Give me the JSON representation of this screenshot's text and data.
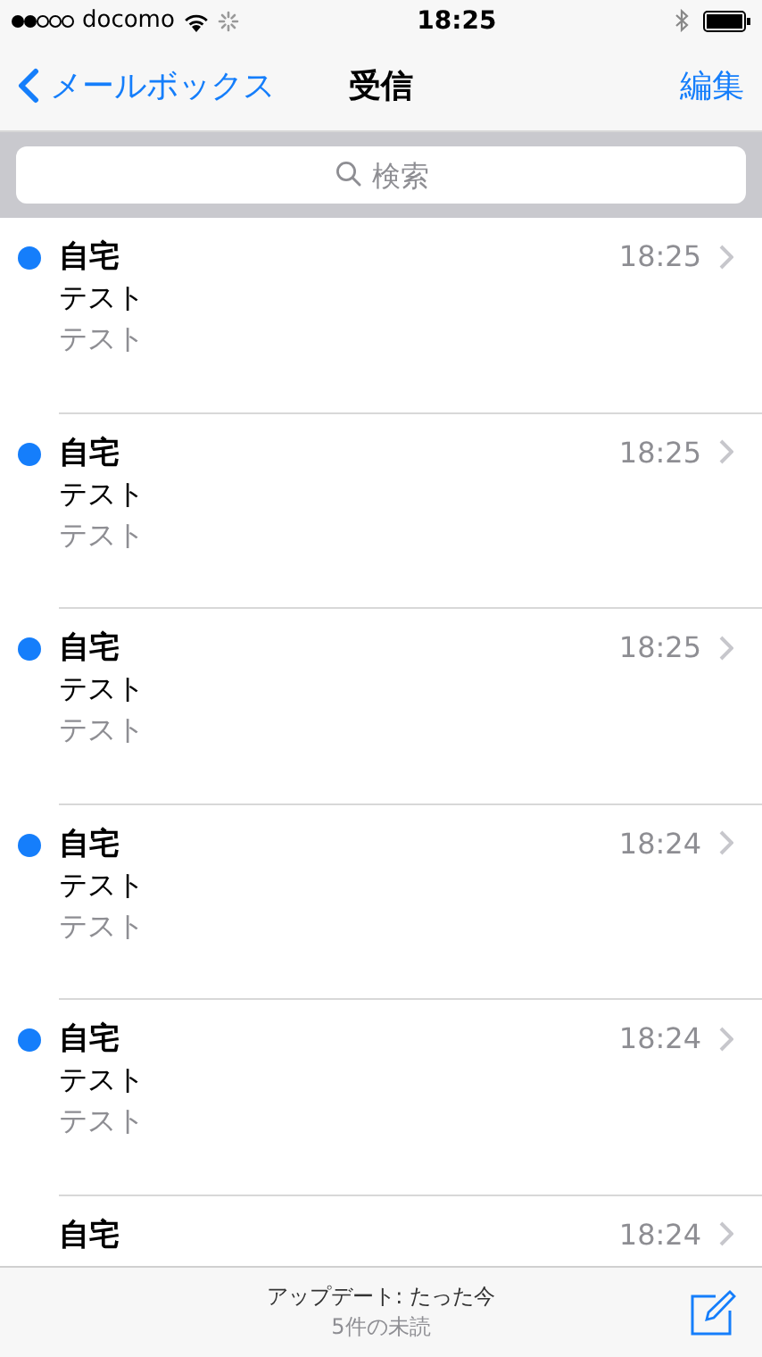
{
  "status_bar": {
    "carrier": "docomo",
    "time": "18:25"
  },
  "nav": {
    "back": "メールボックス",
    "title": "受信",
    "edit": "編集"
  },
  "search": {
    "placeholder": "検索"
  },
  "messages": [
    {
      "sender": "自宅",
      "time": "18:25",
      "subject": "テスト",
      "preview": "テスト",
      "unread": true
    },
    {
      "sender": "自宅",
      "time": "18:25",
      "subject": "テスト",
      "preview": "テスト",
      "unread": true
    },
    {
      "sender": "自宅",
      "time": "18:25",
      "subject": "テスト",
      "preview": "テスト",
      "unread": true
    },
    {
      "sender": "自宅",
      "time": "18:24",
      "subject": "テスト",
      "preview": "テスト",
      "unread": true
    },
    {
      "sender": "自宅",
      "time": "18:24",
      "subject": "テスト",
      "preview": "テスト",
      "unread": true
    },
    {
      "sender": "自宅",
      "time": "18:24",
      "unread": false
    }
  ],
  "toolbar": {
    "updated": "アップデート: たった今",
    "unread_count": "5件の未読"
  }
}
